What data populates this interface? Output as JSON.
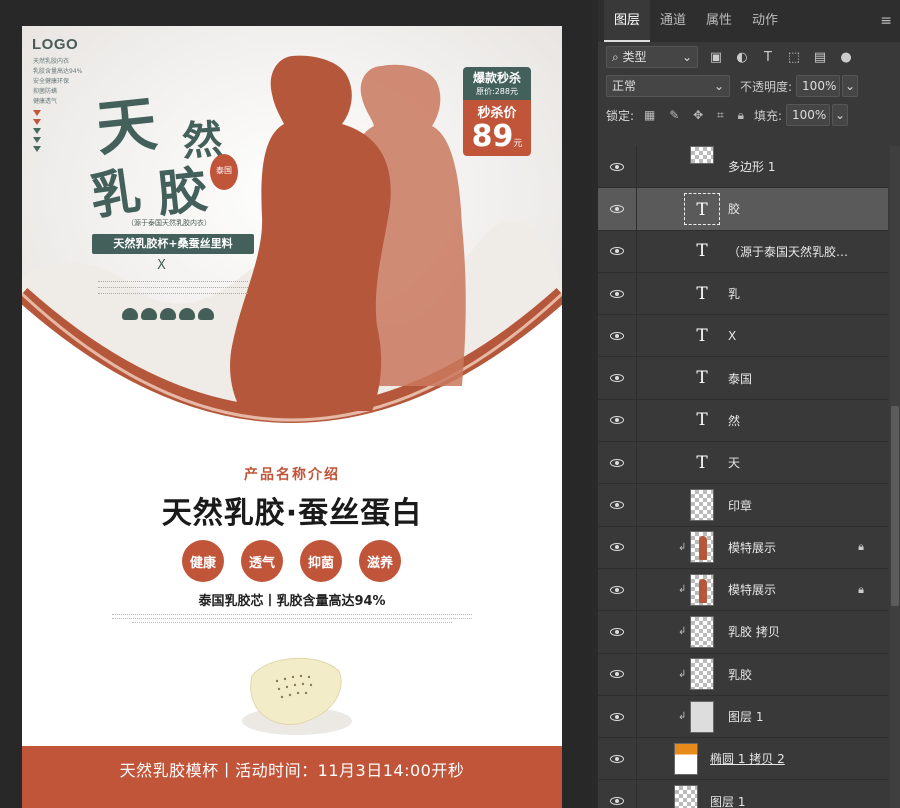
{
  "poster": {
    "logo": "LOGO",
    "logo_lines": [
      "天然乳胶内衣",
      "乳胶含量高达94%",
      "安全健康环保",
      "抑菌防螨",
      "健康透气"
    ],
    "brush_chars": [
      "天",
      "然",
      "乳",
      "胶"
    ],
    "seal_text": "泰国",
    "source_text": "（源于泰国天然乳胶内衣）",
    "green_pill": "天然乳胶杯+桑蚕丝里料",
    "x_mark": "X",
    "promo": {
      "line1": "爆款秒杀",
      "line2": "原价:288元",
      "line3": "秒杀价",
      "price": "89",
      "unit": "元"
    },
    "section_sub": "产品名称介绍",
    "section_title": "天然乳胶·蚕丝蛋白",
    "features": [
      "健康",
      "透气",
      "抑菌",
      "滋养"
    ],
    "feature_line": "泰国乳胶芯丨乳胶含量高达94%",
    "footer": "天然乳胶模杯丨活动时间：11月3日14:00开秒",
    "colors": {
      "accent": "#c0553a",
      "green": "#44605a"
    }
  },
  "panel": {
    "tabs": [
      "图层",
      "通道",
      "属性",
      "动作"
    ],
    "filter_kind": "类型",
    "blend_mode": "正常",
    "opacity_label": "不透明度:",
    "opacity_value": "100%",
    "lock_label": "锁定:",
    "fill_label": "填充:",
    "fill_value": "100%",
    "layers": [
      {
        "name": "多边形 1",
        "thumb": "checker"
      },
      {
        "name": "胶",
        "thumb": "T",
        "selected": true
      },
      {
        "name": "（源于泰国天然乳胶…",
        "thumb": "T"
      },
      {
        "name": "乳",
        "thumb": "T"
      },
      {
        "name": "X",
        "thumb": "T"
      },
      {
        "name": "泰国",
        "thumb": "T"
      },
      {
        "name": "然",
        "thumb": "T"
      },
      {
        "name": "天",
        "thumb": "T"
      },
      {
        "name": "印章",
        "thumb": "checker"
      },
      {
        "name": "模特展示",
        "thumb": "fig",
        "locked": true,
        "clipped": true
      },
      {
        "name": "模特展示",
        "thumb": "fig",
        "locked": true,
        "clipped": true
      },
      {
        "name": "乳胶 拷贝",
        "thumb": "mask",
        "clipped": true
      },
      {
        "name": "乳胶",
        "thumb": "mask",
        "clipped": true
      },
      {
        "name": "图层 1",
        "thumb": "plain",
        "clipped": true
      },
      {
        "name": "椭圆 1 拷贝 2",
        "thumb": "orange"
      },
      {
        "name": "图层 1",
        "thumb": "checker"
      }
    ]
  }
}
